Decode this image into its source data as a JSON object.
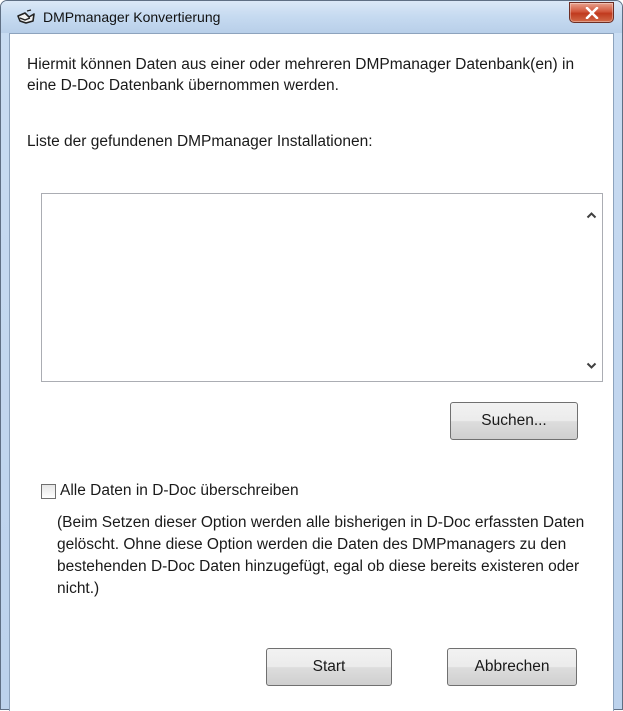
{
  "window": {
    "title": "DMPmanager Konvertierung",
    "app_icon": "dmp-app-icon",
    "close_icon": "close-icon"
  },
  "intro": {
    "text": "Hiermit können Daten aus einer oder mehreren DMPmanager Datenbank(en) in eine D-Doc Datenbank übernommen werden."
  },
  "installations": {
    "label": "Liste der gefundenen DMPmanager Installationen:",
    "items": [],
    "scroll_up_icon": "chevron-up-icon",
    "scroll_down_icon": "chevron-down-icon"
  },
  "search_button": {
    "label": "Suchen..."
  },
  "overwrite_option": {
    "label": "Alle Daten in D-Doc überschreiben",
    "checked": false,
    "note": "(Beim Setzen dieser Option werden alle bisherigen in D-Doc erfassten Daten gelöscht. Ohne diese Option werden die Daten des DMPmanagers zu den bestehenden D-Doc Daten hinzugefügt, egal ob diese bereits existeren oder nicht.)"
  },
  "footer": {
    "start_label": "Start",
    "cancel_label": "Abbrechen"
  },
  "colors": {
    "close_button": "#c7432a",
    "title_bar": "#c7dbf1"
  }
}
